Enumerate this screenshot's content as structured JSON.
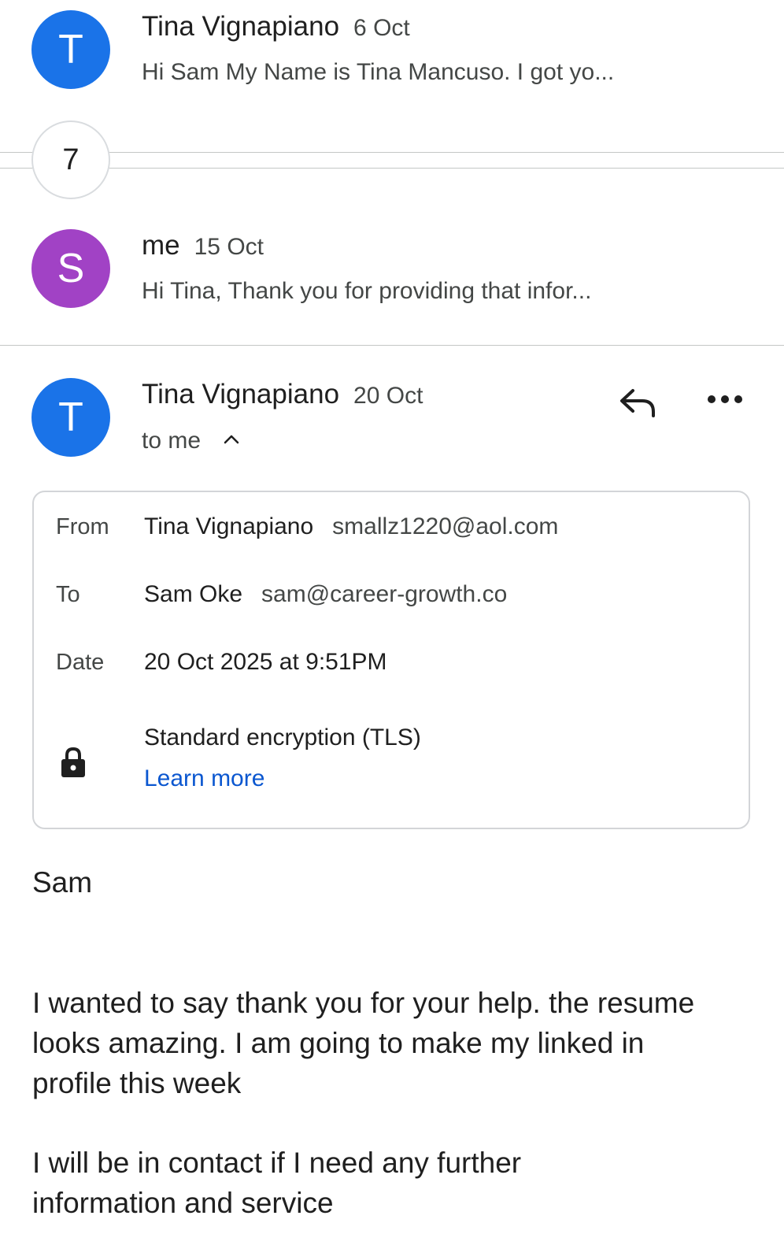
{
  "thread": [
    {
      "avatar_letter": "T",
      "avatar_color": "#1a73e8",
      "sender": "Tina Vignapiano",
      "date": "6 Oct",
      "snippet": "Hi Sam My Name is Tina Mancuso. I got yo..."
    },
    {
      "avatar_letter": "S",
      "avatar_color": "#a142c5",
      "sender": "me",
      "date": "15 Oct",
      "snippet": "Hi Tina, Thank you for providing that infor..."
    }
  ],
  "collapsed_count": "7",
  "open_message": {
    "avatar_letter": "T",
    "avatar_color": "#1a73e8",
    "sender": "Tina Vignapiano",
    "date": "20 Oct",
    "recipient_summary": "to me",
    "details": {
      "from_label": "From",
      "from_name": "Tina Vignapiano",
      "from_email": "smallz1220@aol.com",
      "to_label": "To",
      "to_name": "Sam Oke",
      "to_email": "sam@career-growth.co",
      "date_label": "Date",
      "date_value": "20 Oct 2025 at 9:51PM",
      "encryption": "Standard encryption (TLS)",
      "learn_more": "Learn more"
    },
    "body": {
      "greeting": "Sam",
      "paragraph1": "I wanted to say thank you for your help. the resume looks amazing. I am going to make my linked in profile this week",
      "paragraph2": "I will be in contact if I need any further information and service"
    }
  },
  "icons": {
    "reply": "reply-icon",
    "more": "more-horiz-icon",
    "expand": "chevron-up-icon",
    "lock": "lock-icon"
  },
  "colors": {
    "link": "#0b57d0",
    "avatar_blue": "#1a73e8",
    "avatar_purple": "#a142c5"
  }
}
